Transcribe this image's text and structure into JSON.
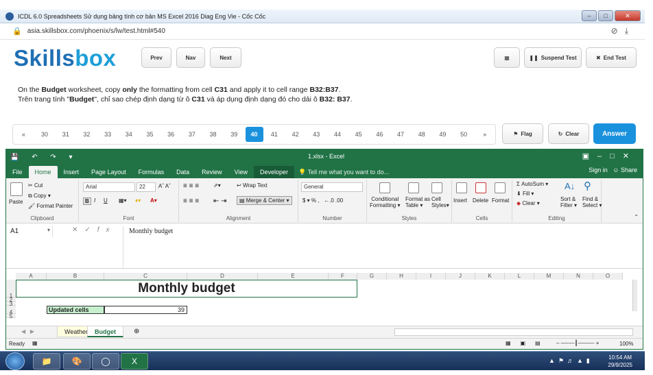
{
  "browser": {
    "window_title": "ICDL 6.0 Spreadsheets Sử dụng bảng tính cơ bản MS Excel 2016 Diag Eng Vie - Cốc Cốc",
    "url": "asia.skillsbox.com/phoenix/s/lw/test.html#540"
  },
  "test": {
    "brand_a": "Skills",
    "brand_b": "box",
    "prev_label": "Prev",
    "nav_label": "Nav",
    "next_label": "Next",
    "suspend_label": "Suspend Test",
    "end_label": "End Test",
    "question_en": {
      "p1": "On the ",
      "b1": "Budget",
      "p2": " worksheet, copy ",
      "b2": "only",
      "p3": " the formatting from cell ",
      "b3": "C31",
      "p4": " and apply it to cell range ",
      "b4": "B32:B37",
      "p5": "."
    },
    "question_vi": {
      "p1": "Trên trang tính \"",
      "b1": "Budget",
      "p2": "\", chỉ sao chép định dạng từ ô ",
      "b2": "C31",
      "p3": " và áp dụng định dạng đó cho dải ô ",
      "b3": "B32: B37",
      "p4": "."
    },
    "nav_prev": "«",
    "nav_next": "»",
    "questions": [
      "30",
      "31",
      "32",
      "33",
      "34",
      "35",
      "36",
      "37",
      "38",
      "39",
      "40",
      "41",
      "42",
      "43",
      "44",
      "45",
      "46",
      "47",
      "48",
      "49",
      "50"
    ],
    "current_question": "40",
    "flag_label": "Flag",
    "clear_label": "Clear",
    "answer_label": "Answer",
    "accent": "#1a91dd"
  },
  "excel": {
    "filename": "1.xlsx - Excel",
    "menu": [
      "File",
      "Home",
      "Insert",
      "Page Layout",
      "Formulas",
      "Data",
      "Review",
      "View",
      "Developer"
    ],
    "active_menu": "Home",
    "tell_me": "Tell me what you want to do...",
    "sign_in": "Sign in",
    "share": "Share",
    "clipboard": {
      "paste": "Paste",
      "cut": "Cut",
      "copy": "Copy",
      "format_painter": "Format Painter",
      "label": "Clipboard"
    },
    "font": {
      "name": "Arial",
      "size": "22",
      "bold": "B",
      "italic": "I",
      "underline": "U",
      "label": "Font"
    },
    "alignment": {
      "wrap": "Wrap Text",
      "merge": "Merge & Center",
      "label": "Alignment"
    },
    "number": {
      "format": "General",
      "label": "Number"
    },
    "styles": {
      "conditional": "Conditional",
      "formatting": "Formatting",
      "format_as": "Format as",
      "table": "Table",
      "cell": "Cell",
      "styles_word": "Styles",
      "label": "Styles"
    },
    "cells": {
      "insert": "Insert",
      "delete": "Delete",
      "format": "Format",
      "label": "Cells"
    },
    "editing": {
      "autosum": "AutoSum",
      "fill": "Fill",
      "clear": "Clear",
      "sort": "Sort &",
      "filter": "Filter",
      "find": "Find &",
      "select": "Select",
      "label": "Editing"
    },
    "name_box": "A1",
    "formula": "Monthly budget",
    "columns": [
      "A",
      "B",
      "C",
      "D",
      "E",
      "F",
      "G",
      "H",
      "I",
      "J",
      "K",
      "L",
      "M",
      "N",
      "O"
    ],
    "rows": [
      "1",
      "2",
      "3",
      "4",
      "5"
    ],
    "title_cell": "Monthly budget",
    "updated_label": "Updated cells",
    "updated_value": "39",
    "sheets": [
      "Weather",
      "Budget"
    ],
    "active_sheet": "Budget",
    "status_ready": "Ready",
    "zoom": "100%",
    "green": "#217346"
  },
  "taskbar": {
    "time": "10:54 AM",
    "date": "29/9/2025"
  }
}
